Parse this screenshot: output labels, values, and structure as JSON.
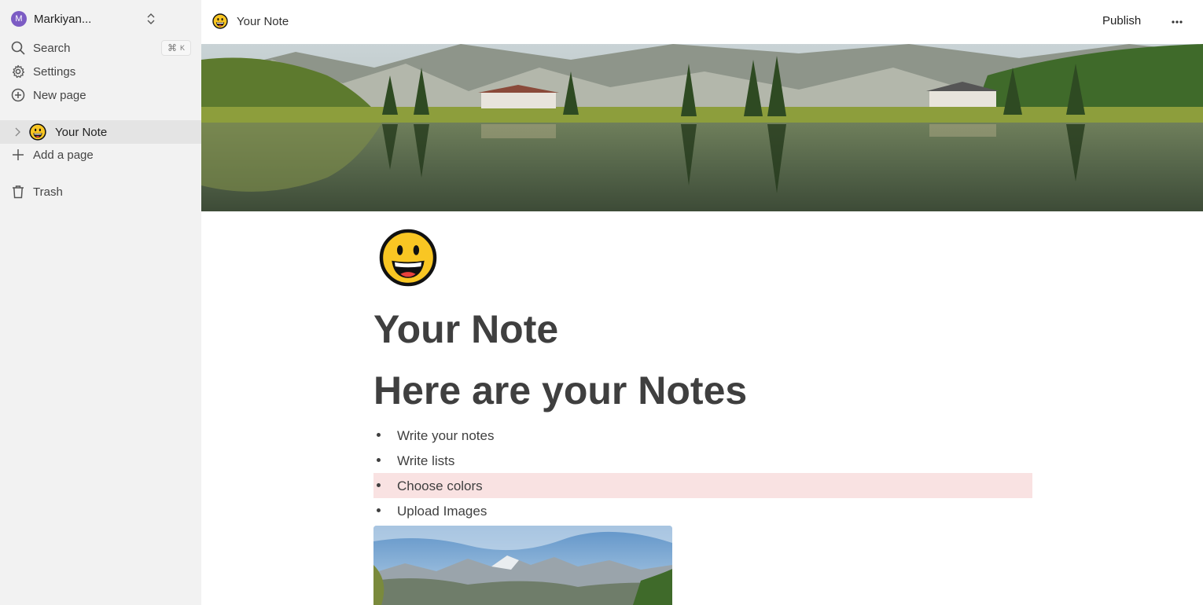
{
  "sidebar": {
    "workspace": {
      "avatar_letter": "M",
      "name": "Markiyan..."
    },
    "search": {
      "label": "Search",
      "shortcut_symbol": "⌘",
      "shortcut_key": "K"
    },
    "settings": {
      "label": "Settings"
    },
    "new_page": {
      "label": "New page"
    },
    "pages": [
      {
        "label": "Your Note",
        "emoji": "grinning-face"
      }
    ],
    "add_page": {
      "label": "Add a page"
    },
    "trash": {
      "label": "Trash"
    }
  },
  "topbar": {
    "page_title": "Your Note",
    "publish_label": "Publish"
  },
  "document": {
    "title": "Your Note",
    "heading": "Here are your Notes",
    "bullets": [
      {
        "text": "Write your notes",
        "highlight": false
      },
      {
        "text": "Write lists",
        "highlight": false
      },
      {
        "text": "Choose colors",
        "highlight": true
      },
      {
        "text": "Upload Images",
        "highlight": false
      }
    ]
  },
  "colors": {
    "sidebar_bg": "#f2f2f2",
    "selected_item_bg": "#e4e4e4",
    "avatar": "#7c5cc4",
    "highlight_red": "#f9e2e2",
    "text": "#3f3f3f"
  }
}
